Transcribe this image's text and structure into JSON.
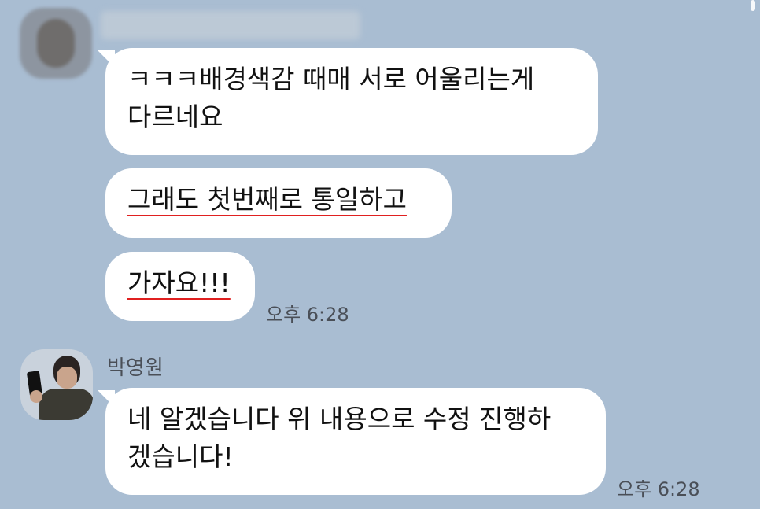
{
  "thread": {
    "first_sender": {
      "avatar_icon": "blurred-profile-photo",
      "name_hidden": true
    },
    "messages_group1": [
      {
        "lines": [
          "ㅋㅋㅋ배경색감 때매 서로 어울리는게",
          "다르네요"
        ]
      },
      {
        "text": "그래도 첫번째로 통일하고"
      },
      {
        "text": "가자요!!!"
      }
    ],
    "group1_time": "오후 6:28",
    "second_sender": {
      "name": "박영원",
      "avatar_icon": "profile-photo-man-with-phone"
    },
    "messages_group2": [
      {
        "lines": [
          "네 알겠습니다 위 내용으로 수정 진행하",
          "겠습니다!"
        ]
      }
    ],
    "group2_time": "오후 6:28"
  },
  "colors": {
    "background": "#a9bdd2",
    "bubble": "#ffffff",
    "underline": "#e02020"
  }
}
